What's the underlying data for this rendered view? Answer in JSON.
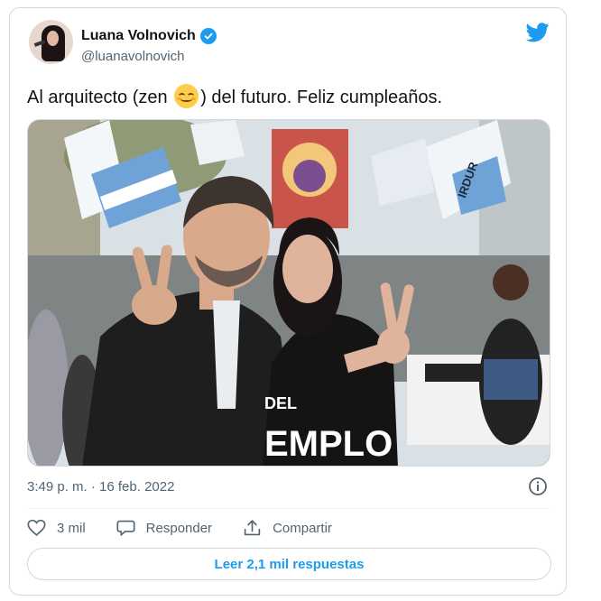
{
  "author": {
    "name": "Luana Volnovich",
    "handle": "@luanavolnovich"
  },
  "tweet": {
    "text_before_emoji": "Al arquitecto (zen ",
    "emoji": "smiling-face-with-smiling-eyes",
    "text_after_emoji": ") del futuro. Feliz cumpleaños.",
    "timestamp": "3:49 p. m. · 16 feb. 2022"
  },
  "photo": {
    "shirt_text_line1": "DEL",
    "shirt_text_line2": "EMPLO",
    "flag_text": "IRDUR"
  },
  "actions": {
    "likes_count": "3 mil",
    "reply_label": "Responder",
    "share_label": "Compartir"
  },
  "replies_button": "Leer 2,1 mil respuestas",
  "colors": {
    "accent": "#1d9bf0",
    "secondary_text": "#536471",
    "border": "#cfd9de"
  }
}
